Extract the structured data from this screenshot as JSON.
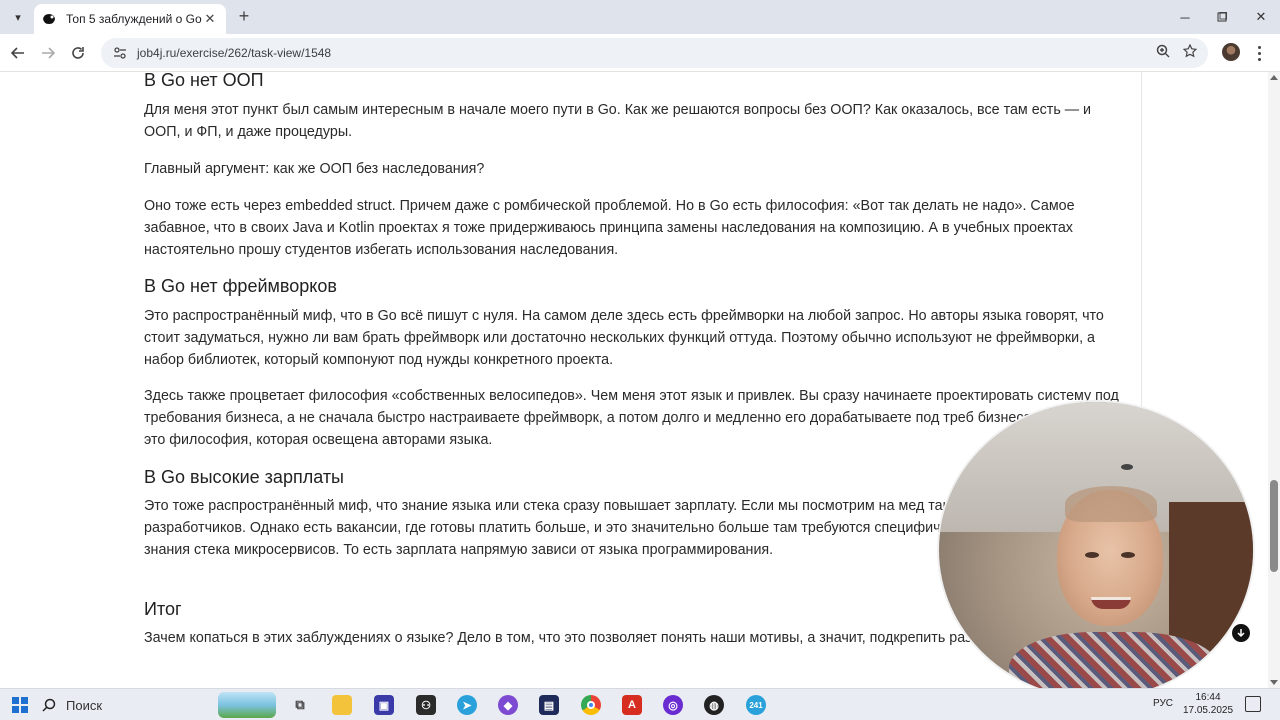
{
  "browser": {
    "tab_title": "Топ 5 заблуждений о GoLang",
    "url": "job4j.ru/exercise/262/task-view/1548"
  },
  "article": {
    "section1": {
      "heading": "В Go нет ООП",
      "p1": "Для меня этот пункт был самым интересным в начале моего пути в Go. Как же решаются вопросы без ООП? Как оказалось, все там есть — и ООП, и ФП, и даже процедуры.",
      "p2": "Главный аргумент: как же ООП без наследования?",
      "p3": "Оно тоже есть через embedded struct. Причем даже с ромбической проблемой. Но в Go есть философия: «Вот так делать не надо». Самое забавное, что в своих Java и Kotlin проектах я тоже придерживаюсь принципа замены наследования на композицию. А в учебных проектах настоятельно прошу студентов избегать использования наследования."
    },
    "section2": {
      "heading": "В Go нет фреймворков",
      "p1": "Это распространённый миф, что в Go всё пишут с нуля. На самом деле здесь есть фреймворки на любой запрос. Но авторы языка говорят, что стоит задуматься, нужно ли вам брать фреймворк или достаточно нескольких функций оттуда. Поэтому обычно используют не фреймворки, а набор библиотек, который компонуют под нужды конкретного проекта.",
      "p2": "Здесь также процветает философия «собственных велосипедов». Чем меня этот язык и привлек. Вы сразу начинаете проектировать систему под требования бизнеса, а не сначала быстро настраиваете фреймворк, а потом долго и медленно его дорабатываете под треб бизнеса. Опять же, это философия, которая освещена авторами языка."
    },
    "section3": {
      "heading": "В Go высокие зарплаты",
      "p1": "Это тоже распространённый миф, что знание языка или стека сразу повышает зарплату. Если мы посмотрим на мед такие же, как и у Java-разработчиков. Однако есть вакансии, где готовы платить больше, и это значительно больше там требуются специфические знания, а не просто знания стека микросервисов. То есть зарплата напрямую зависи от языка программирования."
    },
    "section4": {
      "heading": "Итог",
      "p1": "Зачем копаться в этих заблуждениях о языке? Дело в том, что это позволяет понять наши мотивы, а значит, подкрепить развиваться."
    }
  },
  "taskbar": {
    "search_label": "Поиск",
    "lang": "РУС",
    "time": "16:44",
    "date": "17.05.2025",
    "telegram_badge": "241"
  },
  "icons": {
    "tab_menu": "chevron-down-icon",
    "favicon": "job4j-favicon",
    "close": "close-icon",
    "new_tab": "plus-icon",
    "back": "back-arrow-icon",
    "forward": "forward-arrow-icon",
    "reload": "reload-icon",
    "site_info": "site-settings-icon",
    "zoom": "zoom-icon",
    "bookmark": "star-icon"
  }
}
